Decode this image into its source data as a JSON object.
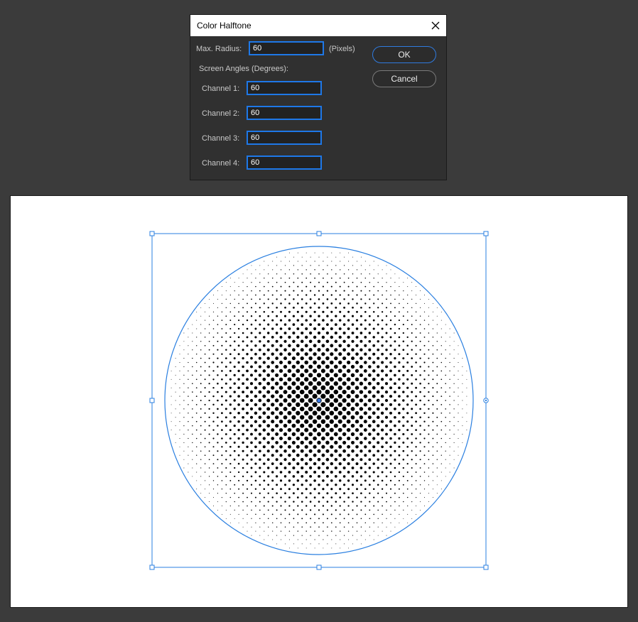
{
  "dialog": {
    "title": "Color Halftone",
    "max_radius_label": "Max. Radius:",
    "max_radius_value": "60",
    "max_radius_unit": "(Pixels)",
    "screen_angles_label": "Screen Angles (Degrees):",
    "channels": [
      {
        "label": "Channel 1:",
        "value": "60"
      },
      {
        "label": "Channel 2:",
        "value": "60"
      },
      {
        "label": "Channel 3:",
        "value": "60"
      },
      {
        "label": "Channel 4:",
        "value": "60"
      }
    ],
    "ok_label": "OK",
    "cancel_label": "Cancel"
  },
  "colors": {
    "accent": "#1e78e8",
    "selection": "#2a7fe0",
    "dot": "#000000",
    "dialog_bg": "#303030",
    "app_bg": "#3b3b3b"
  },
  "icons": {
    "close": "close-icon",
    "bounding_handle": "handle-icon",
    "center_point": "center-point-icon",
    "rotation_handle": "rotate-handle-icon"
  }
}
